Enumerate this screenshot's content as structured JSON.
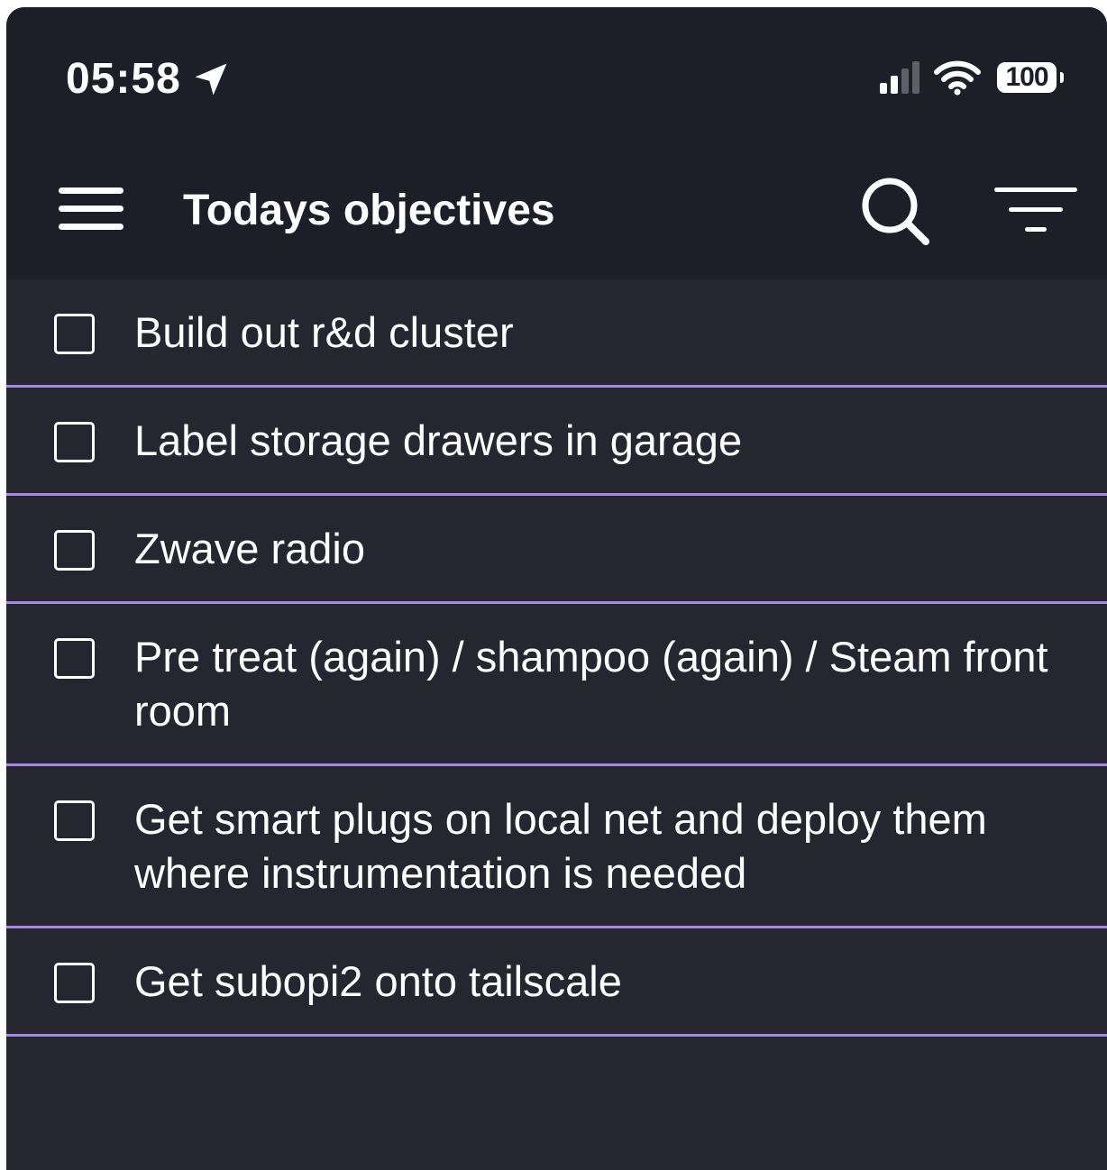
{
  "status": {
    "time": "05:58",
    "battery": "100",
    "icons": [
      "location-arrow-icon",
      "signal-icon",
      "wifi-icon",
      "battery-icon"
    ]
  },
  "header": {
    "title": "Todays objectives",
    "icons": [
      "menu-icon",
      "search-icon",
      "filter-icon"
    ]
  },
  "tasks": [
    {
      "label": "Build out r&d cluster",
      "checked": false
    },
    {
      "label": "Label storage drawers in garage",
      "checked": false
    },
    {
      "label": "Zwave radio",
      "checked": false
    },
    {
      "label": "Pre treat (again) / shampoo (again) / Steam front room",
      "checked": false
    },
    {
      "label": "Get smart plugs on local net and deploy them where instrumentation is needed",
      "checked": false
    },
    {
      "label": "Get subopi2 onto tailscale",
      "checked": false
    }
  ],
  "colors": {
    "header_bg": "#1e1e28",
    "list_bg": "#262631",
    "divider": "#a688e0",
    "text": "#ffffff"
  }
}
